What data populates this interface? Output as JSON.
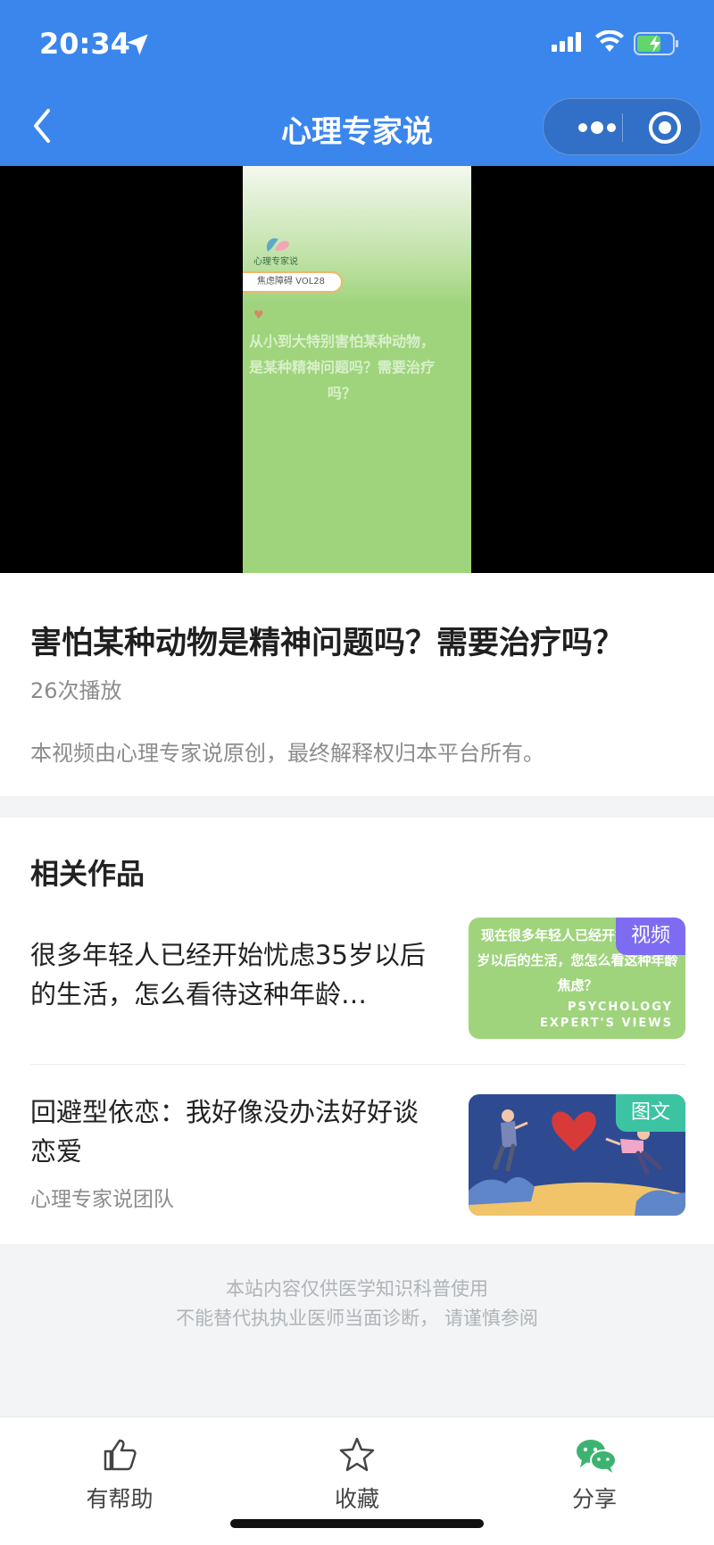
{
  "status_bar": {
    "time": "20:34"
  },
  "nav": {
    "title": "心理专家说"
  },
  "video": {
    "brand": "心理专家说",
    "pill": "焦虑障碍  VOL28",
    "overlay_text": "从小到大特别害怕某种动物，是某种精神问题吗？需要治疗吗？"
  },
  "info": {
    "title": "害怕某种动物是精神问题吗？需要治疗吗？",
    "play_count": "26次播放",
    "copyright": "本视频由心理专家说原创，最终解释权归本平台所有。"
  },
  "related": {
    "heading": "相关作品",
    "items": [
      {
        "title": "很多年轻人已经开始忧虑35岁以后的生活，怎么看待这种年龄…",
        "tag": "视频",
        "thumb_text": "现在很多年轻人已经开始忧虑35岁以后的生活，您怎么看这种年龄焦虑？",
        "thumb_eng_1": "PSYCHOLOGY",
        "thumb_eng_2": "EXPERT'S VIEWS"
      },
      {
        "title": "回避型依恋：我好像没办法好好谈恋爱",
        "author": "心理专家说团队",
        "tag": "图文"
      }
    ]
  },
  "disclaimer": {
    "line1": "本站内容仅供医学知识科普使用",
    "line2": "不能替代执执业医师当面诊断， 请谨慎参阅"
  },
  "bottom_bar": {
    "helpful": "有帮助",
    "favorite": "收藏",
    "share": "分享"
  },
  "colors": {
    "header": "#3b86ec",
    "tag_video": "#7d6cf2",
    "tag_article": "#3cc3a2",
    "wechat_green": "#3cb371"
  }
}
